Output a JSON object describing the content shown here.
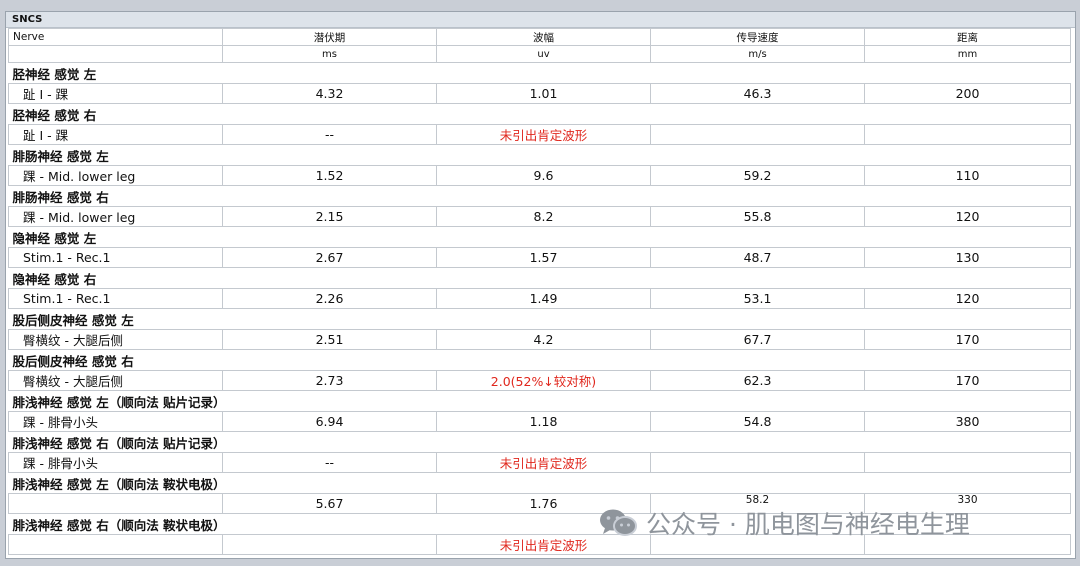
{
  "title": "SNCS",
  "header": {
    "columns": [
      "Nerve",
      "潜伏期",
      "波幅",
      "传导速度",
      "距离"
    ],
    "units": [
      "",
      "ms",
      "uv",
      "m/s",
      "mm"
    ]
  },
  "sections": [
    {
      "title": "胫神经 感觉 左",
      "row": {
        "site": "趾 I - 踝",
        "latency": "4.32",
        "amplitude": "1.01",
        "velocity": "46.3",
        "distance": "200"
      }
    },
    {
      "title": "胫神经 感觉 右",
      "row": {
        "site": "趾 I - 踝",
        "latency": "--",
        "amplitude": "未引出肯定波形",
        "velocity": "",
        "distance": ""
      }
    },
    {
      "title": "腓肠神经 感觉 左",
      "row": {
        "site": "踝 - Mid. lower leg",
        "latency": "1.52",
        "amplitude": "9.6",
        "velocity": "59.2",
        "distance": "110"
      }
    },
    {
      "title": "腓肠神经 感觉 右",
      "row": {
        "site": "踝 - Mid. lower leg",
        "latency": "2.15",
        "amplitude": "8.2",
        "velocity": "55.8",
        "distance": "120"
      }
    },
    {
      "title": "隐神经 感觉 左",
      "row": {
        "site": "Stim.1 - Rec.1",
        "latency": "2.67",
        "amplitude": "1.57",
        "velocity": "48.7",
        "distance": "130"
      }
    },
    {
      "title": "隐神经 感觉 右",
      "row": {
        "site": "Stim.1 - Rec.1",
        "latency": "2.26",
        "amplitude": "1.49",
        "velocity": "53.1",
        "distance": "120"
      }
    },
    {
      "title": "股后侧皮神经 感觉 左",
      "row": {
        "site": "臀横纹 - 大腿后侧",
        "latency": "2.51",
        "amplitude": "4.2",
        "velocity": "67.7",
        "distance": "170"
      }
    },
    {
      "title": "股后侧皮神经 感觉 右",
      "row": {
        "site": "臀横纹 - 大腿后侧",
        "latency": "2.73",
        "amplitude": "2.0(52%↓较对称)",
        "velocity": "62.3",
        "distance": "170"
      }
    },
    {
      "title": "腓浅神经 感觉 左（顺向法 贴片记录）",
      "row": {
        "site": "踝 - 腓骨小头",
        "latency": "6.94",
        "amplitude": "1.18",
        "velocity": "54.8",
        "distance": "380"
      }
    },
    {
      "title": "腓浅神经 感觉 右（顺向法 贴片记录）",
      "row": {
        "site": "踝 - 腓骨小头",
        "latency": "--",
        "amplitude": "未引出肯定波形",
        "velocity": "",
        "distance": ""
      }
    },
    {
      "title": "腓浅神经 感觉 左（顺向法 鞍状电极）",
      "row": {
        "site": "",
        "latency": "5.67",
        "amplitude": "1.76",
        "velocity": "58.2",
        "distance": "330"
      }
    },
    {
      "title": "腓浅神经 感觉 右（顺向法 鞍状电极）",
      "row": {
        "site": "",
        "latency": "",
        "amplitude": "未引出肯定波形",
        "velocity": "",
        "distance": ""
      }
    }
  ],
  "watermark": "公众号 · 肌电图与神经电生理",
  "colors": {
    "alert": "#e0271d",
    "background": "#c9ced6",
    "header_bg": "#dde3ea"
  }
}
